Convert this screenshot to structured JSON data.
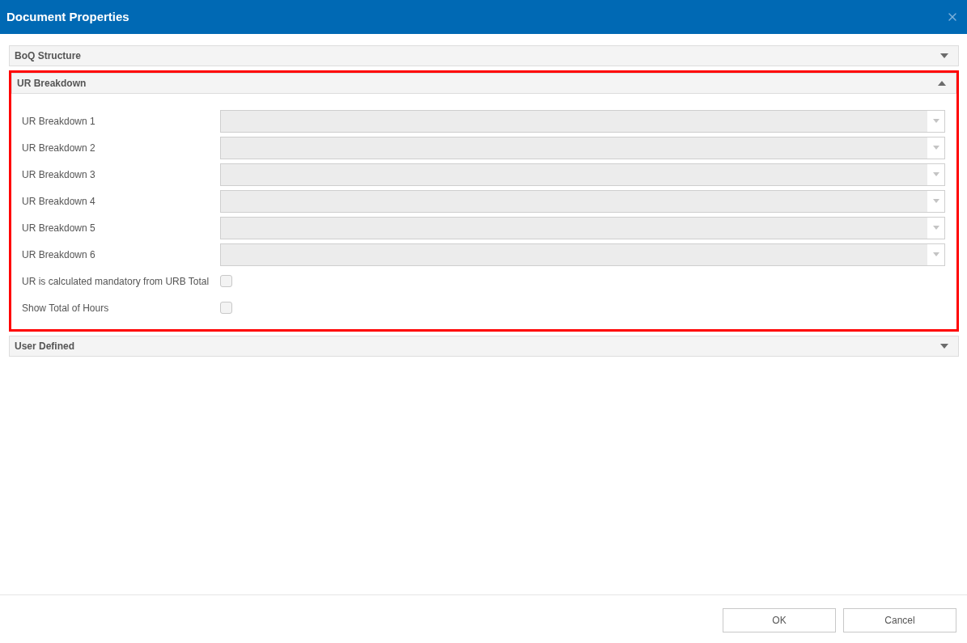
{
  "window": {
    "title": "Document Properties"
  },
  "sections": [
    {
      "title": "BoQ Structure",
      "expanded": false,
      "highlighted": false
    },
    {
      "title": "UR Breakdown",
      "expanded": true,
      "highlighted": true,
      "rows": [
        {
          "kind": "dropdown",
          "label": "UR Breakdown 1",
          "disabled": true
        },
        {
          "kind": "dropdown",
          "label": "UR Breakdown 2",
          "disabled": true
        },
        {
          "kind": "dropdown",
          "label": "UR Breakdown 3",
          "disabled": true
        },
        {
          "kind": "dropdown",
          "label": "UR Breakdown 4",
          "disabled": true
        },
        {
          "kind": "dropdown",
          "label": "UR Breakdown 5",
          "disabled": true
        },
        {
          "kind": "dropdown",
          "label": "UR Breakdown 6",
          "disabled": true
        },
        {
          "kind": "checkbox",
          "label": "UR is calculated mandatory from URB Total",
          "checked": false
        },
        {
          "kind": "checkbox",
          "label": "Show Total of Hours",
          "checked": false
        }
      ]
    },
    {
      "title": "User Defined",
      "expanded": false,
      "highlighted": false
    }
  ],
  "buttons": [
    "OK",
    "Cancel"
  ]
}
